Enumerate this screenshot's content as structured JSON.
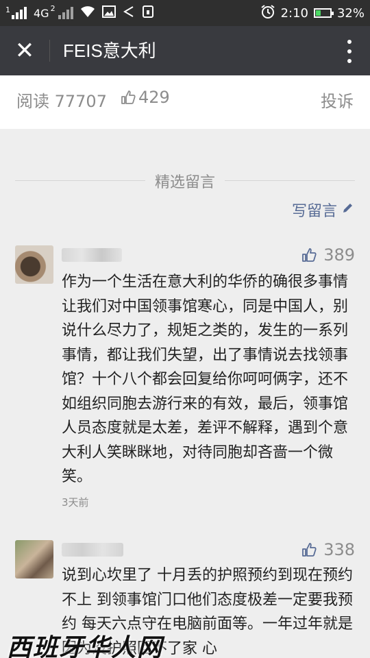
{
  "status_bar": {
    "sim1": "1",
    "network": "4G",
    "sim2": "2",
    "time": "2:10",
    "battery": "32%",
    "battery_level": 0.32
  },
  "title_bar": {
    "title": "FEIS意大利",
    "close_icon": "close-icon",
    "more_icon": "more-vertical-icon"
  },
  "stats": {
    "read_label": "阅读 77707",
    "like_count": "429",
    "complain_label": "投诉"
  },
  "comments_section": {
    "title": "精选留言",
    "write_label": "写留言"
  },
  "comments": [
    {
      "like_count": "389",
      "text": "作为一个生活在意大利的华侨的确很多事情让我们对中国领事馆寒心，同是中国人，别说什么尽力了，规矩之类的，发生的一系列事情，都让我们失望，出了事情说去找领事馆？十个八个都会回复给你呵呵俩字，还不如组织同胞去游行来的有效，最后，领事馆人员态度就是太差，差评不解释，遇到个意大利人笑眯眯地，对待同胞却吝啬一个微笑。",
      "time": "3天前"
    },
    {
      "like_count": "338",
      "text": "说到心坎里了 十月丢的护照预约到现在预约不上 到领事馆门口他们态度极差一定要我预约 每天六点守在电脑前面等。一年过年就是因为没护照回不了家 心"
    }
  ],
  "watermark": {
    "text": "西班牙华人网"
  }
}
